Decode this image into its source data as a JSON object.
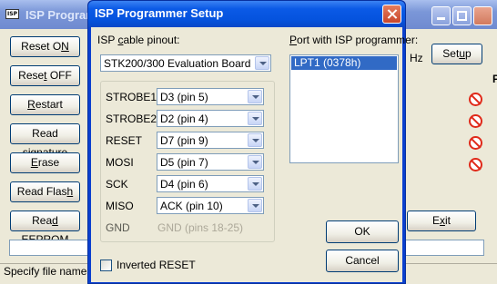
{
  "background_window": {
    "title": "ISP Programmer",
    "buttons": [
      {
        "label_pre": "Reset O",
        "label_u": "N",
        "label_post": ""
      },
      {
        "label_pre": "Rese",
        "label_u": "t",
        "label_post": " OFF"
      },
      {
        "label_pre": "",
        "label_u": "R",
        "label_post": "estart"
      },
      {
        "label_pre": "Read ",
        "label_u": "s",
        "label_post": "ignature"
      },
      {
        "label_pre": "",
        "label_u": "E",
        "label_post": "rase"
      },
      {
        "label_pre": "Read Flas",
        "label_u": "h",
        "label_post": ""
      },
      {
        "label_pre": "Rea",
        "label_u": "d",
        "label_post": " EEPROM"
      }
    ],
    "hz_label": "Hz",
    "setup_button": {
      "label_pre": "Set",
      "label_u": "u",
      "label_post": "p"
    },
    "exit_button": {
      "label_pre": "E",
      "label_u": "x",
      "label_post": "it"
    },
    "status_text": "Specify file name fi",
    "status_icon_count": 4,
    "status_icon": "no-entry-icon",
    "right_edge_text": "P"
  },
  "dialog": {
    "title": "ISP Programmer Setup",
    "cable_label": {
      "pre": "ISP ",
      "u": "c",
      "post": "able pinout:"
    },
    "cable_value": "STK200/300 Evaluation Board",
    "port_label": {
      "pre": "",
      "u": "P",
      "post": "ort with ISP programmer:"
    },
    "ports": [
      "LPT1   (0378h)"
    ],
    "pins": [
      {
        "name": "STROBE1",
        "value": "D3 (pin 5)"
      },
      {
        "name": "STROBE2",
        "value": "D2 (pin 4)"
      },
      {
        "name": "RESET",
        "value": "D7 (pin 9)"
      },
      {
        "name": "MOSI",
        "value": "D5 (pin 7)"
      },
      {
        "name": "SCK",
        "value": "D4 (pin 6)"
      },
      {
        "name": "MISO",
        "value": "ACK (pin 10)"
      }
    ],
    "gnd_label": "GND",
    "gnd_value": "GND (pins 18-25)",
    "inverted_reset_label": "Inverted RESET",
    "inverted_reset_checked": false,
    "ok_label": "OK",
    "cancel_label": "Cancel"
  },
  "colors": {
    "dialog_title_blue": "#0553de",
    "selection": "#316ac5",
    "no_entry_red": "#e02a1a"
  }
}
